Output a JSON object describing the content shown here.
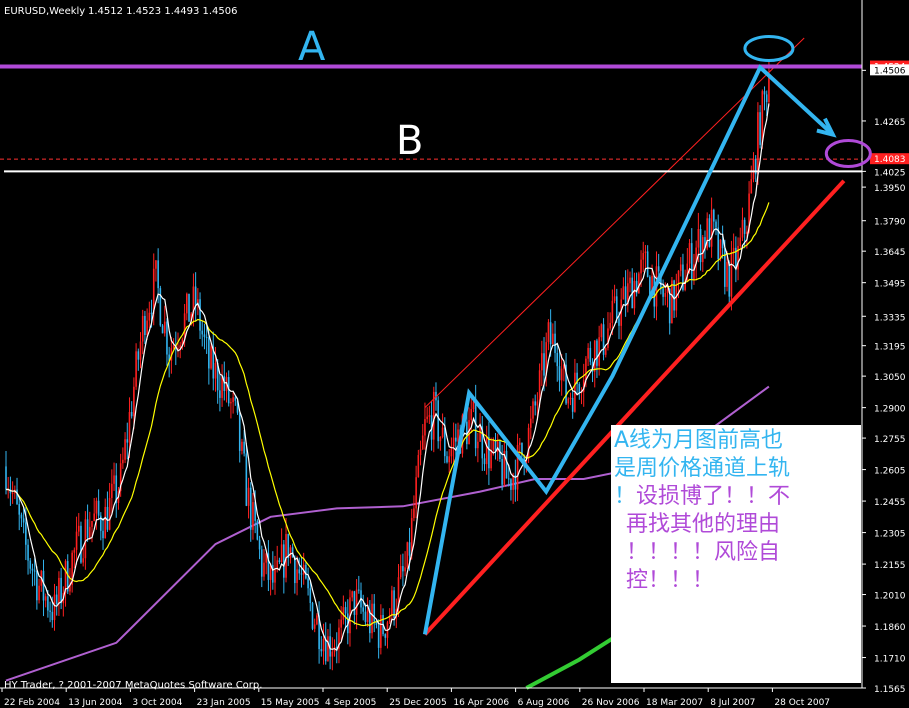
{
  "header": {
    "symbol": "EURUSD,Weekly",
    "ohlc": "1.4512 1.4523 1.4493 1.4506"
  },
  "footer": {
    "copyright": "HY Trader, ? 2001-2007 MetaQuotes Software Corp."
  },
  "annotations": {
    "line_a_label": "A",
    "line_b_label": "B",
    "note_line1": "A线为月图前高也",
    "note_line2": "是周价格通道上轨",
    "note_line3_lead": "！",
    "note_line3": "设损博了！！不",
    "note_line4": "再找其他的理由",
    "note_line5": "！！！！风险自",
    "note_line6": "控！！！"
  },
  "colors": {
    "bull": "#ff2020",
    "bear": "#33b5f0",
    "ma_fast": "#ffffff",
    "ma_mid": "#ffff00",
    "ma_slow": "#b060d0",
    "ma_long": "#33cc33",
    "line_a": "#b04ad8",
    "line_b": "#ffffff",
    "channel": "#ff2020",
    "zigzag": "#33b5f0"
  },
  "chart_data": {
    "type": "candlestick",
    "ylim": [
      1.1565,
      1.466
    ],
    "y_ticks": [
      "1.4506",
      "1.4265",
      "1.4025",
      "1.3950",
      "1.3790",
      "1.3645",
      "1.3495",
      "1.3335",
      "1.3195",
      "1.3050",
      "1.2900",
      "1.2755",
      "1.2605",
      "1.2455",
      "1.2305",
      "1.2155",
      "1.2010",
      "1.1860",
      "1.1710",
      "1.1565"
    ],
    "price_badges": [
      "1.4524",
      "1.4506",
      "1.4083"
    ],
    "x_ticks": [
      "22 Feb 2004",
      "13 Jun 2004",
      "3 Oct 2004",
      "23 Jan 2005",
      "15 May 2005",
      "4 Sep 2005",
      "25 Dec 2005",
      "16 Apr 2006",
      "6 Aug 2006",
      "26 Nov 2006",
      "18 Mar 2007",
      "8 Jul 2007",
      "28 Oct 2007"
    ],
    "price_path": [
      {
        "w": 0,
        "p": 1.262
      },
      {
        "w": 8,
        "p": 1.226
      },
      {
        "w": 15,
        "p": 1.205
      },
      {
        "w": 22,
        "p": 1.193
      },
      {
        "w": 30,
        "p": 1.218
      },
      {
        "w": 38,
        "p": 1.236
      },
      {
        "w": 45,
        "p": 1.238
      },
      {
        "w": 52,
        "p": 1.255
      },
      {
        "w": 58,
        "p": 1.3
      },
      {
        "w": 63,
        "p": 1.335
      },
      {
        "w": 68,
        "p": 1.35
      },
      {
        "w": 74,
        "p": 1.318
      },
      {
        "w": 80,
        "p": 1.33
      },
      {
        "w": 86,
        "p": 1.34
      },
      {
        "w": 92,
        "p": 1.31
      },
      {
        "w": 98,
        "p": 1.302
      },
      {
        "w": 104,
        "p": 1.285
      },
      {
        "w": 110,
        "p": 1.245
      },
      {
        "w": 116,
        "p": 1.215
      },
      {
        "w": 122,
        "p": 1.205
      },
      {
        "w": 128,
        "p": 1.225
      },
      {
        "w": 134,
        "p": 1.208
      },
      {
        "w": 140,
        "p": 1.19
      },
      {
        "w": 146,
        "p": 1.178
      },
      {
        "w": 152,
        "p": 1.182
      },
      {
        "w": 158,
        "p": 1.198
      },
      {
        "w": 164,
        "p": 1.189
      },
      {
        "w": 170,
        "p": 1.183
      },
      {
        "w": 176,
        "p": 1.198
      },
      {
        "w": 182,
        "p": 1.215
      },
      {
        "w": 186,
        "p": 1.25
      },
      {
        "w": 190,
        "p": 1.28
      },
      {
        "w": 194,
        "p": 1.287
      },
      {
        "w": 200,
        "p": 1.268
      },
      {
        "w": 206,
        "p": 1.278
      },
      {
        "w": 212,
        "p": 1.283
      },
      {
        "w": 218,
        "p": 1.27
      },
      {
        "w": 224,
        "p": 1.262
      },
      {
        "w": 228,
        "p": 1.255
      },
      {
        "w": 234,
        "p": 1.268
      },
      {
        "w": 238,
        "p": 1.28
      },
      {
        "w": 242,
        "p": 1.3
      },
      {
        "w": 246,
        "p": 1.322
      },
      {
        "w": 250,
        "p": 1.32
      },
      {
        "w": 254,
        "p": 1.295
      },
      {
        "w": 258,
        "p": 1.3
      },
      {
        "w": 262,
        "p": 1.31
      },
      {
        "w": 266,
        "p": 1.318
      },
      {
        "w": 270,
        "p": 1.32
      },
      {
        "w": 274,
        "p": 1.33
      },
      {
        "w": 280,
        "p": 1.34
      },
      {
        "w": 286,
        "p": 1.352
      },
      {
        "w": 290,
        "p": 1.357
      },
      {
        "w": 296,
        "p": 1.345
      },
      {
        "w": 302,
        "p": 1.34
      },
      {
        "w": 308,
        "p": 1.355
      },
      {
        "w": 314,
        "p": 1.368
      },
      {
        "w": 320,
        "p": 1.375
      },
      {
        "w": 324,
        "p": 1.36
      },
      {
        "w": 328,
        "p": 1.352
      },
      {
        "w": 332,
        "p": 1.362
      },
      {
        "w": 336,
        "p": 1.38
      },
      {
        "w": 338,
        "p": 1.395
      },
      {
        "w": 341,
        "p": 1.42
      },
      {
        "w": 344,
        "p": 1.436
      },
      {
        "w": 346,
        "p": 1.45
      }
    ],
    "series": [
      {
        "kind": "ma_fast",
        "lag": 6
      },
      {
        "kind": "ma_mid",
        "lag": 24
      },
      {
        "kind": "ma_slow"
      },
      {
        "kind": "ma_long"
      }
    ],
    "ma_slow_path": [
      {
        "w": 0,
        "p": 1.16
      },
      {
        "w": 50,
        "p": 1.178
      },
      {
        "w": 95,
        "p": 1.225
      },
      {
        "w": 120,
        "p": 1.238
      },
      {
        "w": 150,
        "p": 1.242
      },
      {
        "w": 180,
        "p": 1.243
      },
      {
        "w": 215,
        "p": 1.25
      },
      {
        "w": 240,
        "p": 1.256
      },
      {
        "w": 262,
        "p": 1.256
      },
      {
        "w": 290,
        "p": 1.262
      },
      {
        "w": 320,
        "p": 1.28
      },
      {
        "w": 346,
        "p": 1.3
      }
    ],
    "ma_long_path": [
      {
        "w": 236,
        "p": 1.1565
      },
      {
        "w": 260,
        "p": 1.17
      },
      {
        "w": 275,
        "p": 1.18
      },
      {
        "w": 282,
        "p": 1.184
      }
    ],
    "line_a_price": 1.4524,
    "line_b_price": 1.4025,
    "dashed_price": 1.4083,
    "channel_lower": [
      {
        "w": 190,
        "p": 1.182
      },
      {
        "w": 380,
        "p": 1.398
      }
    ],
    "channel_upper": [
      {
        "w": 190,
        "p": 1.29
      },
      {
        "w": 362,
        "p": 1.466
      }
    ],
    "zigzag": [
      {
        "w": 190,
        "p": 1.182
      },
      {
        "w": 210,
        "p": 1.297
      },
      {
        "w": 245,
        "p": 1.25
      },
      {
        "w": 275,
        "p": 1.305
      },
      {
        "w": 342,
        "p": 1.452
      },
      {
        "w": 375,
        "p": 1.42
      }
    ]
  }
}
